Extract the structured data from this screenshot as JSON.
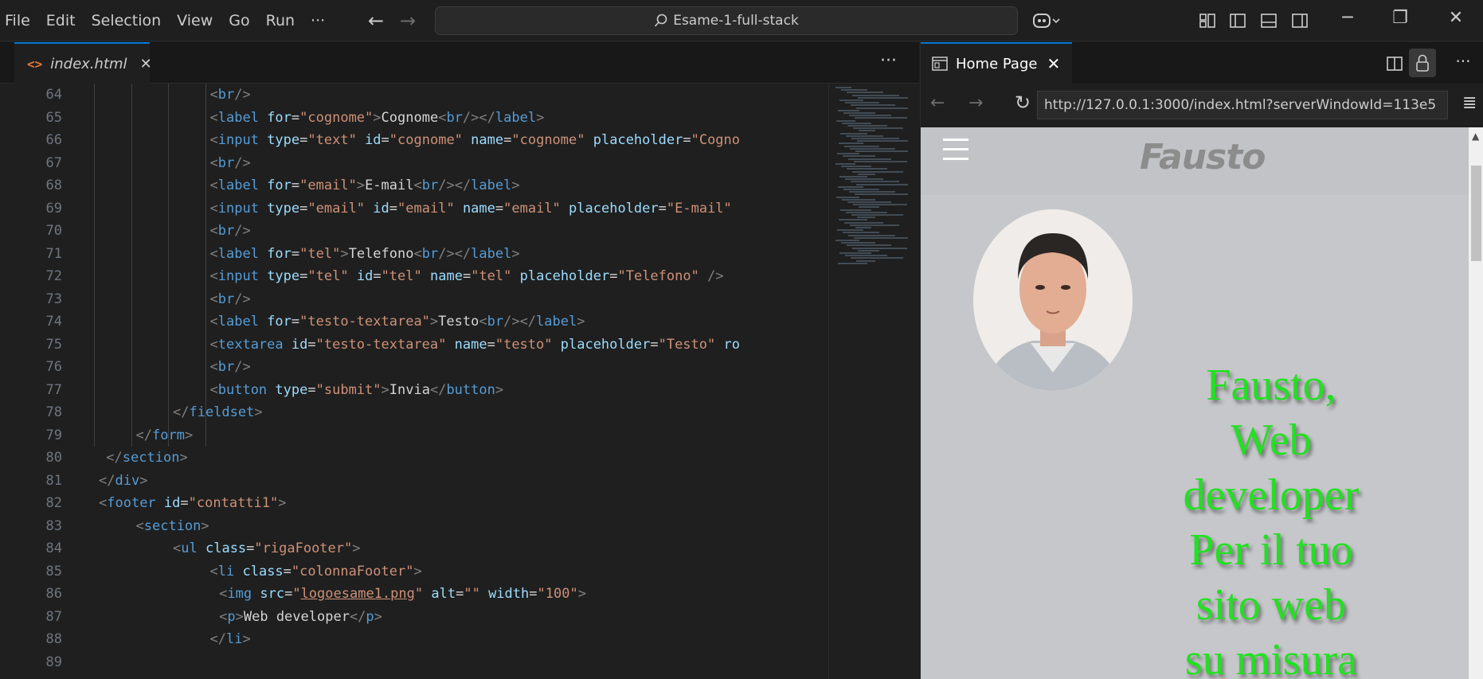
{
  "menu": [
    "File",
    "Edit",
    "Selection",
    "View",
    "Go",
    "Run",
    "···"
  ],
  "command_center": {
    "text": "Esame-1-full-stack"
  },
  "editor": {
    "tab": {
      "filename": "index.html"
    },
    "lines": [
      {
        "n": "64",
        "indent": 4,
        "html": "<span class='br'>&lt;</span><span class='tg'>br</span><span class='br'>/&gt;</span>"
      },
      {
        "n": "65",
        "indent": 4,
        "html": "<span class='br'>&lt;</span><span class='tg'>label</span> <span class='at'>for</span><span class='tx'>=</span><span class='st'>\"cognome\"</span><span class='br'>&gt;</span><span class='tx'>Cognome</span><span class='br'>&lt;</span><span class='tg'>br</span><span class='br'>/&gt;&lt;/</span><span class='tg'>label</span><span class='br'>&gt;</span>"
      },
      {
        "n": "66",
        "indent": 4,
        "html": "<span class='br'>&lt;</span><span class='tg'>input</span> <span class='at'>type</span><span class='tx'>=</span><span class='st'>\"text\"</span> <span class='at'>id</span><span class='tx'>=</span><span class='st'>\"cognome\"</span> <span class='at'>name</span><span class='tx'>=</span><span class='st'>\"cognome\"</span> <span class='at'>placeholder</span><span class='tx'>=</span><span class='st'>\"Cogno</span>"
      },
      {
        "n": "67",
        "indent": 4,
        "html": "<span class='br'>&lt;</span><span class='tg'>br</span><span class='br'>/&gt;</span>"
      },
      {
        "n": "68",
        "indent": 4,
        "html": "<span class='br'>&lt;</span><span class='tg'>label</span> <span class='at'>for</span><span class='tx'>=</span><span class='st'>\"email\"</span><span class='br'>&gt;</span><span class='tx'>E-mail</span><span class='br'>&lt;</span><span class='tg'>br</span><span class='br'>/&gt;&lt;/</span><span class='tg'>label</span><span class='br'>&gt;</span>"
      },
      {
        "n": "69",
        "indent": 4,
        "html": "<span class='br'>&lt;</span><span class='tg'>input</span> <span class='at'>type</span><span class='tx'>=</span><span class='st'>\"email\"</span> <span class='at'>id</span><span class='tx'>=</span><span class='st'>\"email\"</span> <span class='at'>name</span><span class='tx'>=</span><span class='st'>\"email\"</span> <span class='at'>placeholder</span><span class='tx'>=</span><span class='st'>\"E-mail\"</span>"
      },
      {
        "n": "70",
        "indent": 4,
        "html": "<span class='br'>&lt;</span><span class='tg'>br</span><span class='br'>/&gt;</span>"
      },
      {
        "n": "71",
        "indent": 4,
        "html": "<span class='br'>&lt;</span><span class='tg'>label</span> <span class='at'>for</span><span class='tx'>=</span><span class='st'>\"tel\"</span><span class='br'>&gt;</span><span class='tx'>Telefono</span><span class='br'>&lt;</span><span class='tg'>br</span><span class='br'>/&gt;&lt;/</span><span class='tg'>label</span><span class='br'>&gt;</span>"
      },
      {
        "n": "72",
        "indent": 4,
        "html": "<span class='br'>&lt;</span><span class='tg'>input</span> <span class='at'>type</span><span class='tx'>=</span><span class='st'>\"tel\"</span> <span class='at'>id</span><span class='tx'>=</span><span class='st'>\"tel\"</span> <span class='at'>name</span><span class='tx'>=</span><span class='st'>\"tel\"</span> <span class='at'>placeholder</span><span class='tx'>=</span><span class='st'>\"Telefono\"</span> <span class='br'>/&gt;</span>"
      },
      {
        "n": "73",
        "indent": 4,
        "html": "<span class='br'>&lt;</span><span class='tg'>br</span><span class='br'>/&gt;</span>"
      },
      {
        "n": "74",
        "indent": 4,
        "html": "<span class='br'>&lt;</span><span class='tg'>label</span> <span class='at'>for</span><span class='tx'>=</span><span class='st'>\"testo-textarea\"</span><span class='br'>&gt;</span><span class='tx'>Testo</span><span class='br'>&lt;</span><span class='tg'>br</span><span class='br'>/&gt;&lt;/</span><span class='tg'>label</span><span class='br'>&gt;</span>"
      },
      {
        "n": "75",
        "indent": 4,
        "html": "<span class='br'>&lt;</span><span class='tg'>textarea</span> <span class='at'>id</span><span class='tx'>=</span><span class='st'>\"testo-textarea\"</span> <span class='at'>name</span><span class='tx'>=</span><span class='st'>\"testo\"</span> <span class='at'>placeholder</span><span class='tx'>=</span><span class='st'>\"Testo\"</span> <span class='at'>ro</span>"
      },
      {
        "n": "76",
        "indent": 4,
        "html": "<span class='br'>&lt;</span><span class='tg'>br</span><span class='br'>/&gt;</span>"
      },
      {
        "n": "77",
        "indent": 4,
        "html": "<span class='br'>&lt;</span><span class='tg'>button</span> <span class='at'>type</span><span class='tx'>=</span><span class='st'>\"submit\"</span><span class='br'>&gt;</span><span class='tx'>Invia</span><span class='br'>&lt;/</span><span class='tg'>button</span><span class='br'>&gt;</span>"
      },
      {
        "n": "78",
        "indent": 3,
        "html": "<span class='br'>&lt;/</span><span class='tg'>fieldset</span><span class='br'>&gt;</span>"
      },
      {
        "n": "79",
        "indent": 2,
        "html": "<span class='br'>&lt;/</span><span class='tg'>form</span><span class='br'>&gt;</span>"
      },
      {
        "n": "80",
        "indent": 1.2,
        "html": "<span class='br'>&lt;/</span><span class='tg'>section</span><span class='br'>&gt;</span>"
      },
      {
        "n": "81",
        "indent": 1,
        "html": "<span class='br'>&lt;/</span><span class='tg'>div</span><span class='br'>&gt;</span>"
      },
      {
        "n": "82",
        "indent": 1,
        "html": "<span class='br'>&lt;</span><span class='tg'>footer</span> <span class='at'>id</span><span class='tx'>=</span><span class='st'>\"contatti1\"</span><span class='br'>&gt;</span>"
      },
      {
        "n": "83",
        "indent": 2,
        "html": "<span class='br'>&lt;</span><span class='tg'>section</span><span class='br'>&gt;</span>"
      },
      {
        "n": "84",
        "indent": 3,
        "html": "<span class='br'>&lt;</span><span class='tg'>ul</span> <span class='at'>class</span><span class='tx'>=</span><span class='st'>\"rigaFooter\"</span><span class='br'>&gt;</span>"
      },
      {
        "n": "85",
        "indent": 4,
        "html": "<span class='br'>&lt;</span><span class='tg'>li</span> <span class='at'>class</span><span class='tx'>=</span><span class='st'>\"colonnaFooter\"</span><span class='br'>&gt;</span>"
      },
      {
        "n": "86",
        "indent": 4.25,
        "html": "<span class='br'>&lt;</span><span class='tg'>img</span> <span class='at'>src</span><span class='tx'>=</span><span class='st'>\"<u>logoesame1.png</u>\"</span> <span class='at'>alt</span><span class='tx'>=</span><span class='st'>\"\"</span> <span class='at'>width</span><span class='tx'>=</span><span class='st'>\"100\"</span><span class='br'>&gt;</span>"
      },
      {
        "n": "87",
        "indent": 4.25,
        "html": "<span class='br'>&lt;</span><span class='tg'>p</span><span class='br'>&gt;</span><span class='tx'>Web developer</span><span class='br'>&lt;/</span><span class='tg'>p</span><span class='br'>&gt;</span>"
      },
      {
        "n": "88",
        "indent": 4,
        "html": "<span class='br'>&lt;/</span><span class='tg'>li</span><span class='br'>&gt;</span>"
      },
      {
        "n": "89",
        "indent": 4,
        "html": ""
      }
    ]
  },
  "browser": {
    "tab_label": "Home Page",
    "url": "http://127.0.0.1:3000/index.html?serverWindowId=113e5",
    "page": {
      "logo_text": "Fausto",
      "hero_lines": [
        "Fausto,",
        "Web",
        "developer",
        "Per il tuo",
        "sito web",
        "su misura"
      ]
    }
  },
  "colors": {
    "accent": "#0078d4",
    "hero_text": "#22e022",
    "viewport_bg": "#c6c7ca"
  }
}
